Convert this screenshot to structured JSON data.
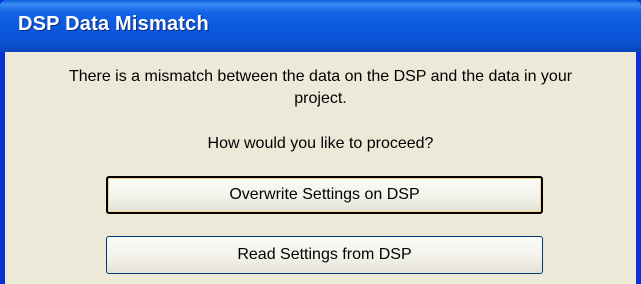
{
  "window": {
    "title": "DSP Data Mismatch"
  },
  "dialog": {
    "message_line1": "There is a mismatch between the data on the DSP and the data in your",
    "message_line2": "project.",
    "question": "How would you like to proceed?"
  },
  "buttons": {
    "overwrite_label": "Overwrite Settings on DSP",
    "read_label": "Read Settings from DSP"
  },
  "colors": {
    "titlebar": "#0b5ae0",
    "frame": "#0831d9",
    "dialog_background": "#ece9d8",
    "title_text": "#ffffff"
  }
}
